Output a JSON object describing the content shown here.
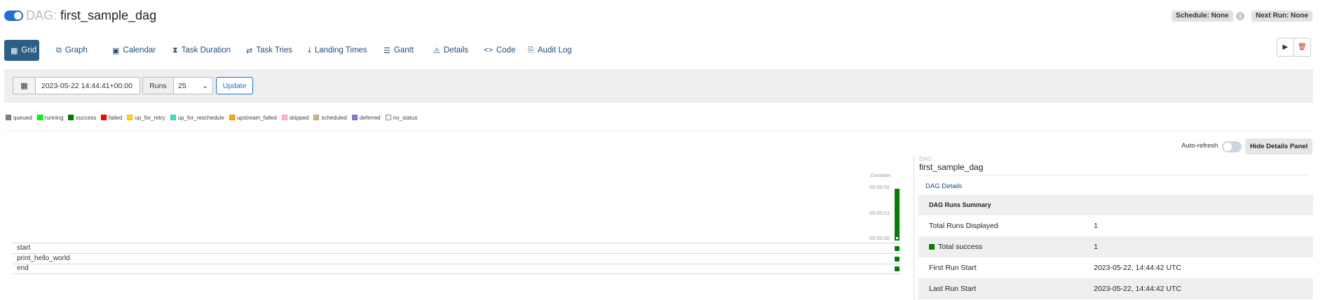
{
  "header": {
    "dag_prefix": "DAG:",
    "dag_id": "first_sample_dag",
    "schedule": "Schedule: None",
    "next_run": "Next Run: None",
    "info": "i"
  },
  "tabs": [
    {
      "label": "Grid",
      "icon": "grid-icon",
      "glyph": "▦"
    },
    {
      "label": "Graph",
      "icon": "graph-icon",
      "glyph": "⧉"
    },
    {
      "label": "Calendar",
      "icon": "calendar-icon",
      "glyph": "▣"
    },
    {
      "label": "Task Duration",
      "icon": "hourglass-icon",
      "glyph": "⧗"
    },
    {
      "label": "Task Tries",
      "icon": "retry-icon",
      "glyph": "⇄"
    },
    {
      "label": "Landing Times",
      "icon": "landing-icon",
      "glyph": "⤓"
    },
    {
      "label": "Gantt",
      "icon": "gantt-icon",
      "glyph": "☰"
    },
    {
      "label": "Details",
      "icon": "warning-icon",
      "glyph": "⚠"
    },
    {
      "label": "Code",
      "icon": "code-icon",
      "glyph": "<>"
    },
    {
      "label": "Audit Log",
      "icon": "file-icon",
      "glyph": "⎘"
    }
  ],
  "actions": {
    "trigger_glyph": "▶",
    "delete_glyph": "🗑"
  },
  "filters": {
    "base_date": "2023-05-22 14:44:41+00:00",
    "runs_label": "Runs",
    "runs_value": "25",
    "update_label": "Update",
    "calendar_glyph": "▦",
    "select_glyph": "⌄"
  },
  "legend": [
    {
      "label": "queued",
      "color": "#808080"
    },
    {
      "label": "running",
      "color": "#00ff00"
    },
    {
      "label": "success",
      "color": "#008000"
    },
    {
      "label": "failed",
      "color": "#ff0000"
    },
    {
      "label": "up_for_retry",
      "color": "#ffd700"
    },
    {
      "label": "up_for_reschedule",
      "color": "#40e0d0"
    },
    {
      "label": "upstream_failed",
      "color": "#ffa500"
    },
    {
      "label": "skipped",
      "color": "#ffb6c1"
    },
    {
      "label": "scheduled",
      "color": "#d2b48c"
    },
    {
      "label": "deferred",
      "color": "#9370db"
    },
    {
      "label": "no_status",
      "color": "#ffffff"
    }
  ],
  "grid": {
    "duration_label": "Duration",
    "ticks": [
      "00:00:02",
      "00:00:01",
      "00:00:00"
    ],
    "tasks": [
      "start",
      "print_hello_world",
      "end"
    ],
    "run_state": "success"
  },
  "details": {
    "auto_refresh_label": "Auto-refresh",
    "hide_button": "Hide Details Panel",
    "type_label": "DAG",
    "title": "first_sample_dag",
    "details_link": "DAG Details",
    "summary_header": "DAG Runs Summary",
    "rows": [
      {
        "key": "Total Runs Displayed",
        "value": "1"
      },
      {
        "key": "Total success",
        "value": "1"
      },
      {
        "key": "First Run Start",
        "value": "2023-05-22, 14:44:42 UTC"
      },
      {
        "key": "Last Run Start",
        "value": "2023-05-22, 14:44:42 UTC"
      }
    ]
  },
  "colors": {
    "accent": "#2c5f87",
    "link": "#1e4c7b",
    "success": "#008000",
    "toggle_on": "#1f6fd1"
  }
}
